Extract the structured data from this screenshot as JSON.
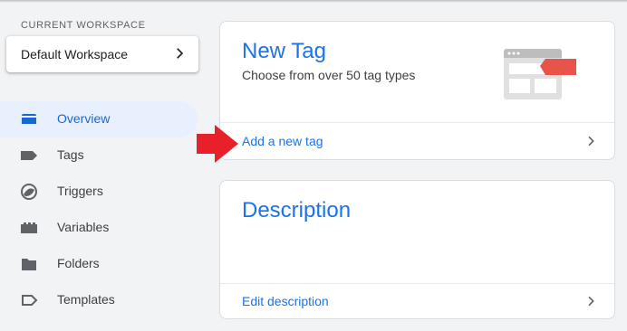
{
  "sidebar": {
    "workspace_label": "CURRENT WORKSPACE",
    "workspace_name": "Default Workspace",
    "items": [
      {
        "label": "Overview",
        "icon": "overview-icon",
        "active": true
      },
      {
        "label": "Tags",
        "icon": "tag-icon"
      },
      {
        "label": "Triggers",
        "icon": "trigger-icon"
      },
      {
        "label": "Variables",
        "icon": "variables-icon"
      },
      {
        "label": "Folders",
        "icon": "folder-icon"
      },
      {
        "label": "Templates",
        "icon": "template-icon"
      }
    ]
  },
  "new_tag_card": {
    "title": "New Tag",
    "subtitle": "Choose from over 50 tag types",
    "link": "Add a new tag"
  },
  "description_card": {
    "title": "Description",
    "link": "Edit description"
  },
  "colors": {
    "accent": "#1a73e8",
    "active_bg": "#e8f0fe",
    "annotation_arrow": "#e8202a",
    "illustration_tag": "#e8534a"
  }
}
